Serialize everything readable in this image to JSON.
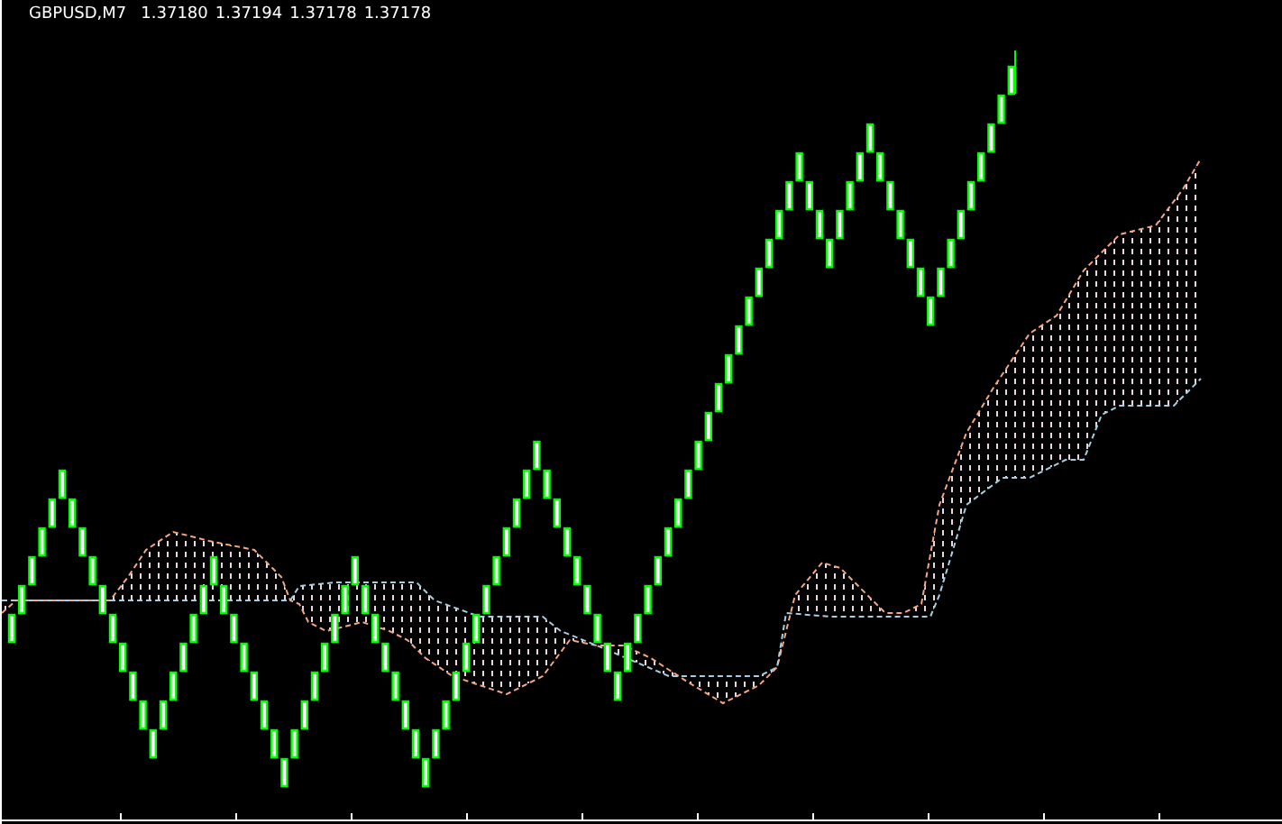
{
  "chart": {
    "symbol": "GBPUSD,M7",
    "prices": [
      "1.37180",
      "1.37194",
      "1.37178",
      "1.37178"
    ]
  }
}
